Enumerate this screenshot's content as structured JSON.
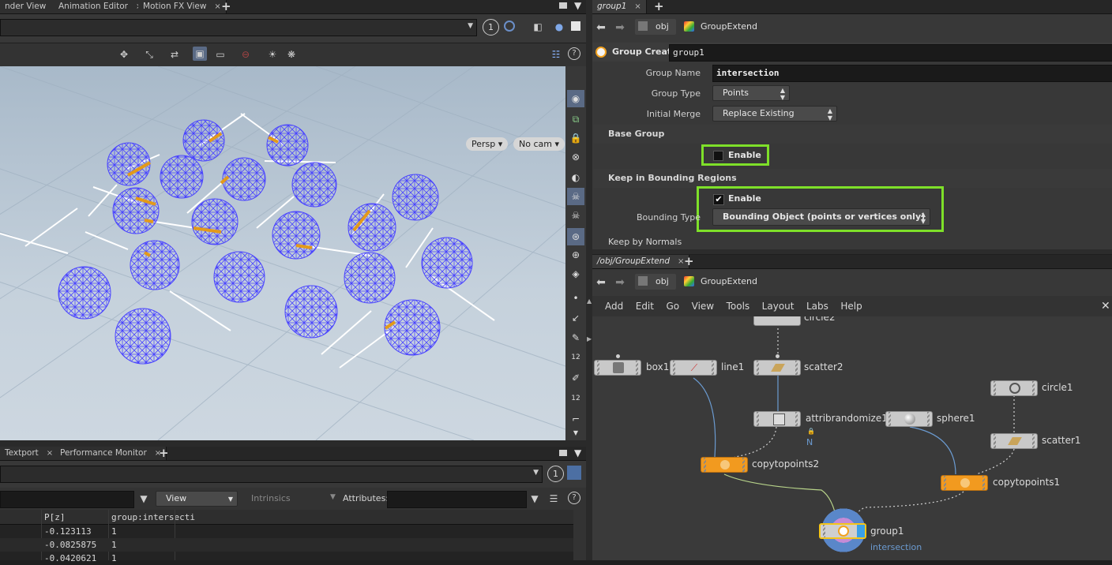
{
  "top_left_tabs": [
    "nder View",
    "Animation Editor",
    "Motion FX View"
  ],
  "tab_close": "×",
  "tab_add": "+",
  "viewport": {
    "persp": "Persp",
    "cam": "No cam",
    "toolbar_icons": [
      "transform-icon",
      "handle-icon",
      "snap-icon",
      "select-icon",
      "display-icon",
      "ghost-icon",
      "light-icon",
      "gear-icon"
    ],
    "right_circle_value": "1"
  },
  "bottom_left_tabs": [
    "Textport",
    "Performance Monitor"
  ],
  "spreadsheet": {
    "view_label": "View",
    "intrinsics_label": "Intrinsics",
    "attributes_label": "Attributes:",
    "columns": [
      "P[z]",
      "group:intersecti"
    ],
    "rows": [
      [
        "-0.123113",
        "1"
      ],
      [
        "-0.0825875",
        "1"
      ],
      [
        "-0.0420621",
        "1"
      ]
    ],
    "circle_value": "1"
  },
  "param_panel": {
    "tab": "group1",
    "path_obj": "obj",
    "path_node": "GroupExtend",
    "node_type": "Group Create",
    "node_name": "group1",
    "group_name_label": "Group Name",
    "group_name_value": "intersection",
    "group_type_label": "Group Type",
    "group_type_value": "Points",
    "initial_merge_label": "Initial Merge",
    "initial_merge_value": "Replace Existing",
    "base_group_section": "Base Group",
    "enable_label": "Enable",
    "keep_bounding_section": "Keep in Bounding Regions",
    "enable_checked_label": "Enable",
    "check_mark": "✔",
    "bounding_type_label": "Bounding Type",
    "bounding_type_value": "Bounding Object (points or vertices only)",
    "keep_normals_section": "Keep by Normals",
    "accent_highlight": "#7ee029"
  },
  "network": {
    "tab": "/obj/GroupExtend",
    "path_obj": "obj",
    "path_node": "GroupExtend",
    "menu": [
      "Add",
      "Edit",
      "Go",
      "View",
      "Tools",
      "Layout",
      "Labs",
      "Help"
    ],
    "nodes": {
      "circle2": "circle2",
      "box1": "box1",
      "line1": "line1",
      "scatter2": "scatter2",
      "attribrandomize1": "attribrandomize1",
      "sphere1": "sphere1",
      "circle1": "circle1",
      "scatter1": "scatter1",
      "copytopoints2": "copytopoints2",
      "copytopoints1": "copytopoints1",
      "group1": "group1",
      "group1_sub": "intersection",
      "attrib_flag": "N"
    }
  }
}
